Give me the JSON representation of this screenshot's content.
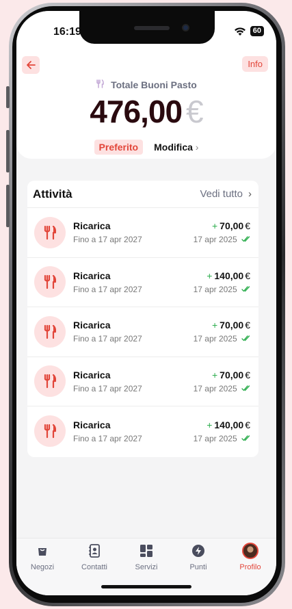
{
  "status": {
    "time": "16:19",
    "battery": "60"
  },
  "header": {
    "info_label": "Info",
    "total_label": "Totale Buoni Pasto",
    "amount": "476,00",
    "currency": "€",
    "preferito": "Preferito",
    "modifica": "Modifica"
  },
  "activity": {
    "title": "Attività",
    "see_all": "Vedi tutto",
    "items": [
      {
        "title": "Ricarica",
        "sub": "Fino a 17 apr 2027",
        "amount": "70,00",
        "date": "17 apr 2025"
      },
      {
        "title": "Ricarica",
        "sub": "Fino a 17 apr 2027",
        "amount": "140,00",
        "date": "17 apr 2025"
      },
      {
        "title": "Ricarica",
        "sub": "Fino a 17 apr 2027",
        "amount": "70,00",
        "date": "17 apr 2025"
      },
      {
        "title": "Ricarica",
        "sub": "Fino a 17 apr 2027",
        "amount": "70,00",
        "date": "17 apr 2025"
      },
      {
        "title": "Ricarica",
        "sub": "Fino a 17 apr 2027",
        "amount": "140,00",
        "date": "17 apr 2025"
      }
    ],
    "plus": "+",
    "currency": "€"
  },
  "tabbar": {
    "items": [
      {
        "label": "Negozi",
        "icon": "bag-icon"
      },
      {
        "label": "Contatti",
        "icon": "contacts-icon"
      },
      {
        "label": "Servizi",
        "icon": "grid-icon"
      },
      {
        "label": "Punti",
        "icon": "bolt-icon"
      },
      {
        "label": "Profilo",
        "icon": "avatar"
      }
    ],
    "active": "Profilo"
  },
  "colors": {
    "accent": "#e2463a",
    "accent_bg": "#fde1e1",
    "positive": "#2eae4f"
  }
}
